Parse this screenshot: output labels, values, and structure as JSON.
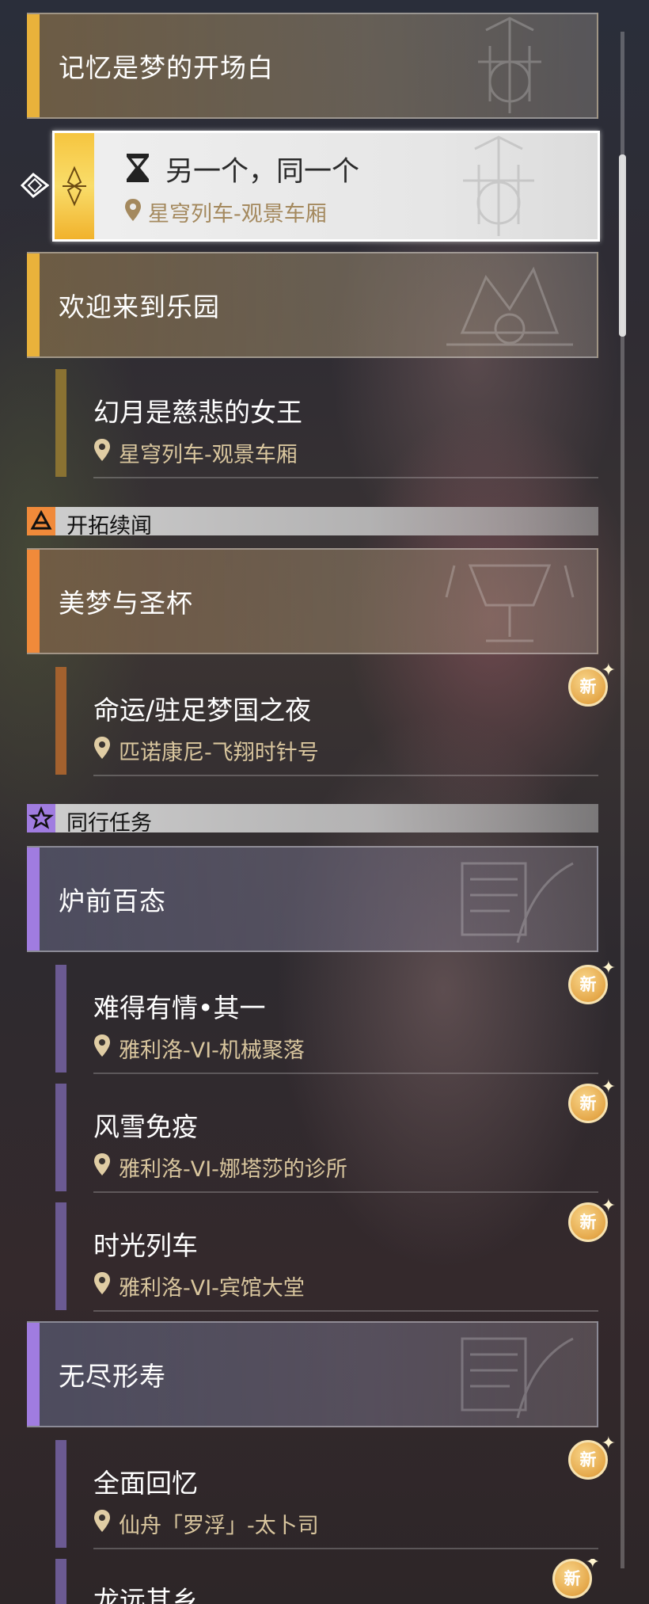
{
  "colors": {
    "gold_accent": "#e9b23b",
    "orange_accent": "#f08a3a",
    "purple_accent": "#a07ce0",
    "location_text": "#d9c69e",
    "new_badge": "#e5a84a"
  },
  "groups": [
    {
      "title": "记忆是梦的开场白",
      "accent": "gold"
    },
    {
      "title": "欢迎来到乐园",
      "accent": "gold"
    },
    {
      "title": "美梦与圣杯",
      "accent": "orange"
    },
    {
      "title": "炉前百态",
      "accent": "purple"
    },
    {
      "title": "无尽形寿",
      "accent": "purple"
    }
  ],
  "selected_quest": {
    "title": "另一个，同一个",
    "location": "星穹列车-观景车厢",
    "icon": "hourglass-icon"
  },
  "quests": [
    {
      "title": "幻月是慈悲的女王",
      "location": "星穹列车-观景车厢",
      "new": false
    },
    {
      "title": "命运/驻足梦国之夜",
      "location": "匹诺康尼-飞翔时针号",
      "new": true
    },
    {
      "title": "难得有情•其一",
      "location": "雅利洛-VI-机械聚落",
      "new": true
    },
    {
      "title": "风雪免疫",
      "location": "雅利洛-VI-娜塔莎的诊所",
      "new": true
    },
    {
      "title": "时光列车",
      "location": "雅利洛-VI-宾馆大堂",
      "new": true
    },
    {
      "title": "全面回忆",
      "location": "仙舟「罗浮」-太卜司",
      "new": true
    },
    {
      "title": "龙远其乡",
      "location": "",
      "new": true
    }
  ],
  "sections": [
    {
      "label": "开拓续闻",
      "icon": "trailblaze-icon"
    },
    {
      "label": "同行任务",
      "icon": "star-icon"
    }
  ],
  "new_badge_label": "新"
}
